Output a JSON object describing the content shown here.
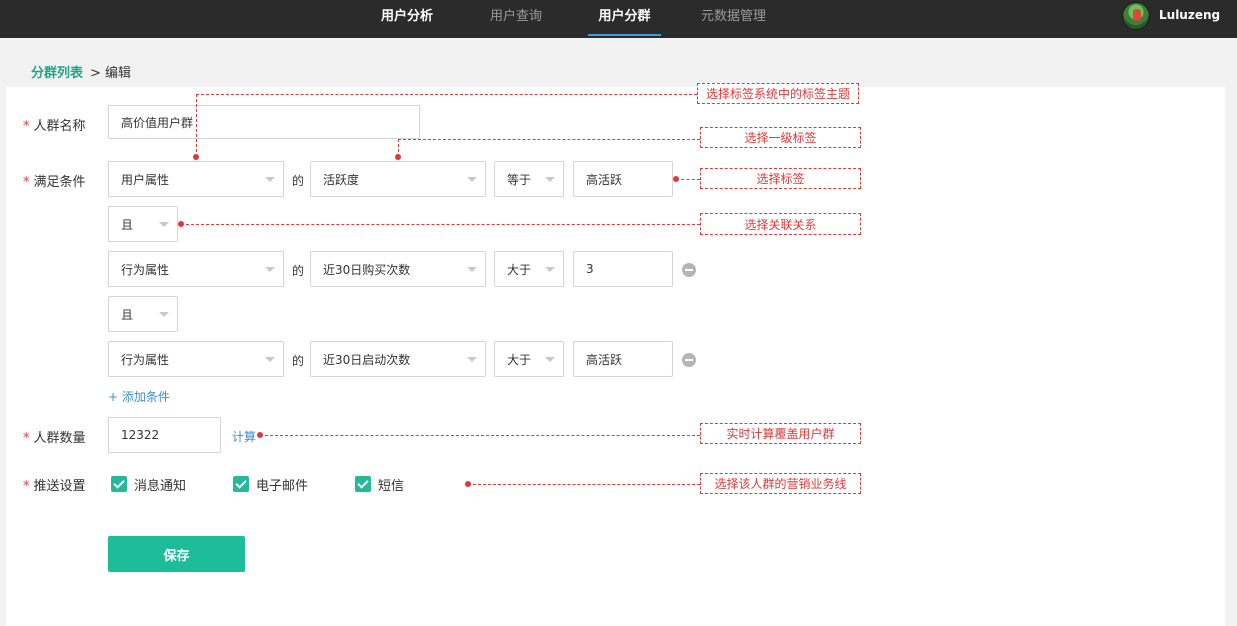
{
  "nav": {
    "tabs": [
      {
        "label": "用户分析",
        "bold": true,
        "active": false
      },
      {
        "label": "用户查询",
        "bold": false,
        "active": false
      },
      {
        "label": "用户分群",
        "bold": true,
        "active": true
      },
      {
        "label": "元数据管理",
        "bold": false,
        "active": false
      }
    ],
    "username": "Luluzeng"
  },
  "breadcrumb": {
    "root": "分群列表",
    "current": "> 编辑"
  },
  "form": {
    "name": {
      "label": "人群名称",
      "value": "高价值用户群"
    },
    "conditions": {
      "label": "满足条件",
      "of": "的",
      "rows": [
        {
          "type": "用户属性",
          "field": "活跃度",
          "op": "等于",
          "value": "高活跃"
        },
        {
          "type": "行为属性",
          "field": "近30日购买次数",
          "op": "大于",
          "value": "3"
        },
        {
          "type": "行为属性",
          "field": "近30日启动次数",
          "op": "大于",
          "value": "高活跃"
        }
      ],
      "relations": [
        "且",
        "且"
      ],
      "add_label": "+ 添加条件"
    },
    "count": {
      "label": "人群数量",
      "value": "12322",
      "calc_label": "计算"
    },
    "push": {
      "label": "推送设置",
      "options": [
        {
          "label": "消息通知",
          "checked": true
        },
        {
          "label": "电子邮件",
          "checked": true
        },
        {
          "label": "短信",
          "checked": true
        }
      ]
    },
    "save_label": "保存"
  },
  "annotations": {
    "theme": "选择标签系统中的标签主题",
    "level1": "选择一级标签",
    "tag": "选择标签",
    "relation": "选择关联关系",
    "realtime": "实时计算覆盖用户群",
    "business": "选择该人群的营销业务线"
  },
  "colors": {
    "accent": "#1dbd9a",
    "link": "#3a8fd0",
    "annotation": "#e03838",
    "nav_bg": "#2b2b2b"
  }
}
